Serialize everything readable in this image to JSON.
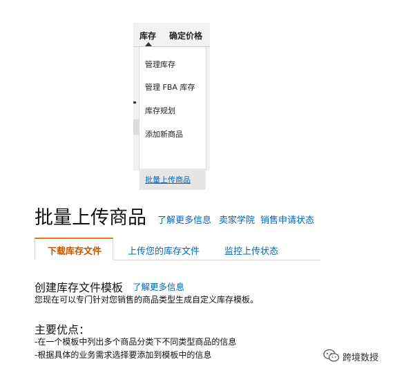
{
  "dropdown": {
    "nav_items": [
      "库存",
      "确定价格"
    ],
    "menu_items": [
      "管理库存",
      "管理 FBA 库存",
      "库存规划",
      "添加新商品",
      "批量上传商品"
    ]
  },
  "page": {
    "title": "批量上传商品",
    "title_links": [
      "了解更多信息",
      "卖家学院",
      "销售申请状态"
    ],
    "tabs": [
      "下载库存文件",
      "上传您的库存文件",
      "监控上传状态"
    ]
  },
  "section": {
    "title": "创建库存文件模板",
    "link": "了解更多信息",
    "desc": "您现在可以专门针对您销售的商品类型生成自定义库存模板。"
  },
  "advantages": {
    "title": "主要优点：",
    "items": [
      "-在一个模板中列出多个商品分类下不同类型商品的信息",
      "-根据具体的业务需求选择要添加到模板中的信息"
    ]
  },
  "watermark": {
    "text": "跨境数授",
    "icon": "wechat-icon"
  },
  "colors": {
    "link": "#0066c0",
    "tab_active_text": "#c45500",
    "tab_active_border": "#e47911"
  }
}
